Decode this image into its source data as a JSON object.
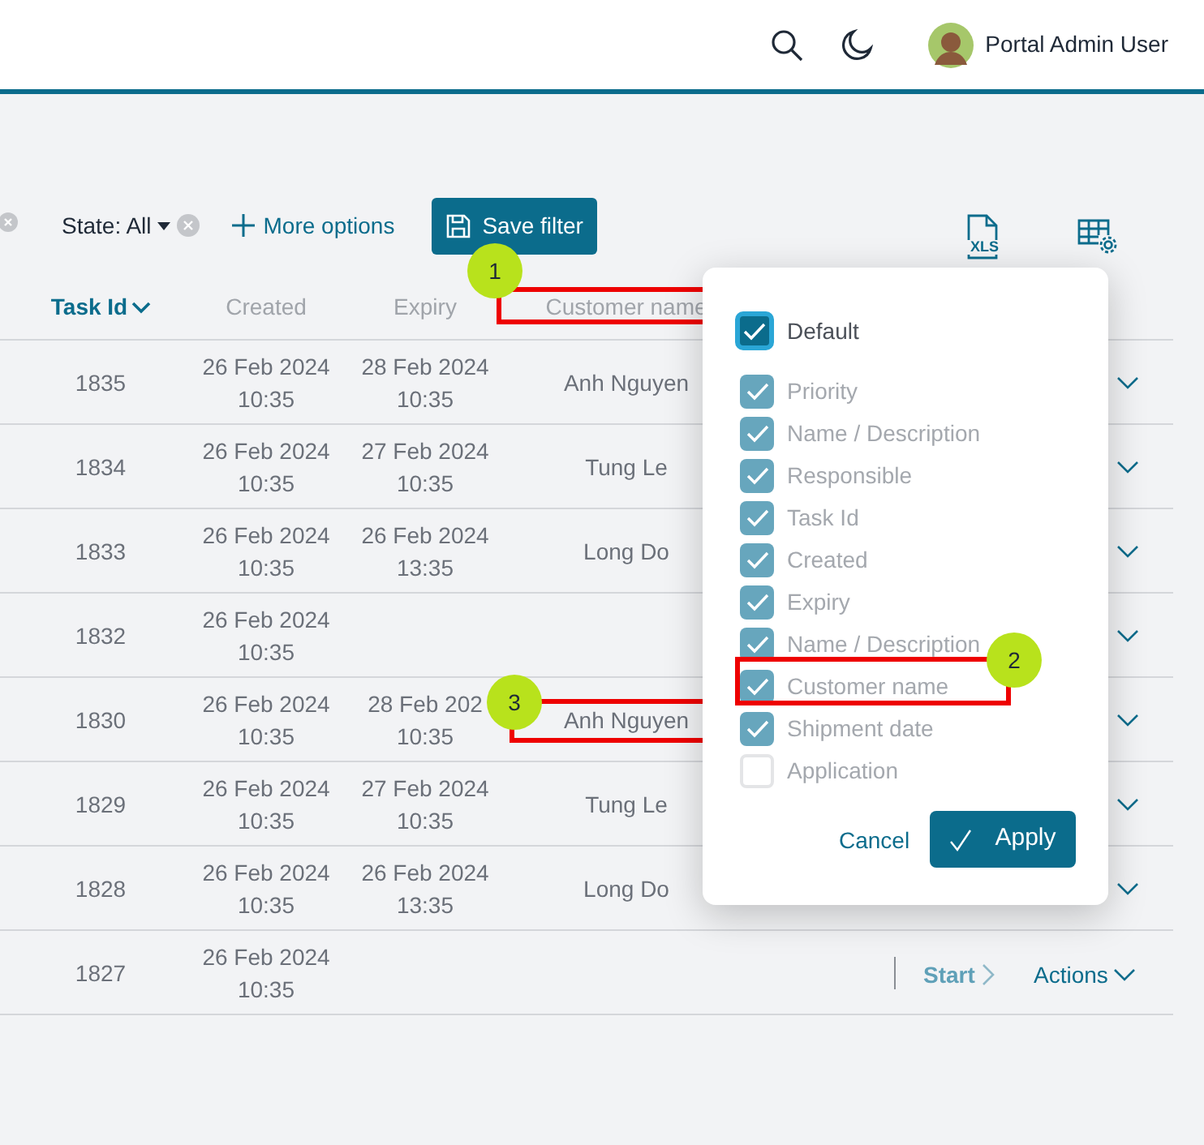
{
  "header": {
    "user_name": "Portal Admin User"
  },
  "filters": {
    "export_label": "XLS",
    "state": {
      "label": "State: All"
    },
    "more_options": "More options",
    "save_filter": "Save filter"
  },
  "table": {
    "columns": [
      {
        "label": "Task Id",
        "selected": true
      },
      {
        "label": "Created",
        "selected": false
      },
      {
        "label": "Expiry",
        "selected": false
      },
      {
        "label": "Customer name",
        "selected": false
      }
    ],
    "rows": [
      {
        "task_id": "1835",
        "created": [
          "26 Feb 2024",
          "10:35"
        ],
        "expiry": [
          "28 Feb 2024",
          "10:35"
        ],
        "customer": "Anh Nguyen",
        "kind": "covered"
      },
      {
        "task_id": "1834",
        "created": [
          "26 Feb 2024",
          "10:35"
        ],
        "expiry": [
          "27 Feb 2024",
          "10:35"
        ],
        "customer": "Tung Le",
        "kind": "covered"
      },
      {
        "task_id": "1833",
        "created": [
          "26 Feb 2024",
          "10:35"
        ],
        "expiry": [
          "26 Feb 2024",
          "13:35"
        ],
        "customer": "Long Do",
        "kind": "covered"
      },
      {
        "task_id": "1832",
        "created": [
          "26 Feb 2024",
          "10:35"
        ],
        "kind": "covered"
      },
      {
        "task_id": "1830",
        "created": [
          "26 Feb 2024",
          "10:35"
        ],
        "expiry": [
          "28 Feb 202",
          "10:35"
        ],
        "customer": "Anh Nguyen",
        "kind": "covered"
      },
      {
        "task_id": "1829",
        "created": [
          "26 Feb 2024",
          "10:35"
        ],
        "expiry": [
          "27 Feb 2024",
          "10:35"
        ],
        "customer": "Tung Le",
        "kind": "covered"
      },
      {
        "task_id": "1828",
        "created": [
          "26 Feb 2024",
          "10:35"
        ],
        "expiry": [
          "26 Feb 2024",
          "13:35"
        ],
        "customer": "Long Do",
        "kind": "covered"
      },
      {
        "task_id": "1827",
        "created": [
          "26 Feb 2024",
          "10:35"
        ],
        "kind": "full",
        "start": "Start",
        "actions": "Actions"
      }
    ]
  },
  "column_picker": {
    "default": {
      "label": "Default",
      "checked": true
    },
    "items": [
      {
        "label": "Priority",
        "checked": true
      },
      {
        "label": "Name / Description",
        "checked": true
      },
      {
        "label": "Responsible",
        "checked": true
      },
      {
        "label": "Task Id",
        "checked": true
      },
      {
        "label": "Created",
        "checked": true
      },
      {
        "label": "Expiry",
        "checked": true
      },
      {
        "label": "Name / Description",
        "checked": true
      },
      {
        "label": "Customer name",
        "checked": true
      },
      {
        "label": "Shipment date",
        "checked": true
      },
      {
        "label": "Application",
        "checked": false
      }
    ],
    "cancel": "Cancel",
    "apply": "Apply"
  },
  "annotations": [
    {
      "number": "1"
    },
    {
      "number": "2"
    },
    {
      "number": "3"
    }
  ]
}
